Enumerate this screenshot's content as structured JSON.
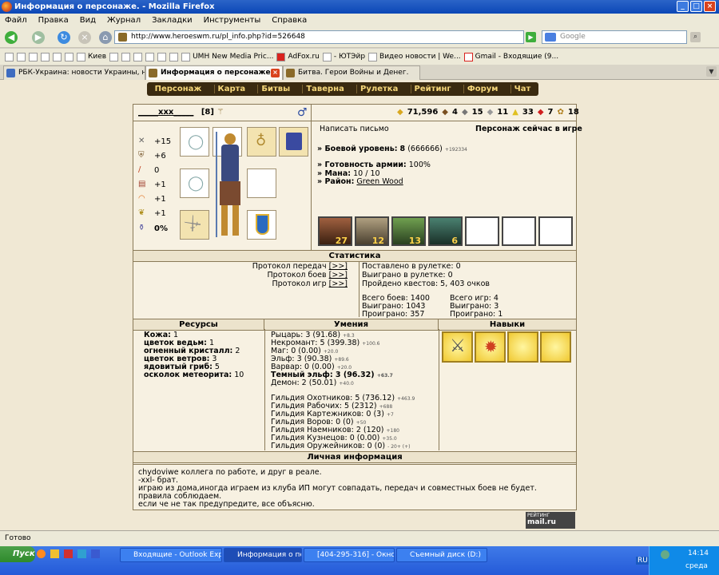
{
  "window": {
    "title": "Информация о персонаже. - Mozilla Firefox"
  },
  "menu": [
    "Файл",
    "Правка",
    "Вид",
    "Журнал",
    "Закладки",
    "Инструменты",
    "Справка"
  ],
  "url": "http://www.heroeswm.ru/pl_info.php?id=526648",
  "search_placeholder": "Google",
  "bookmarks": [
    "Киев",
    "UMH New Media Pric...",
    "AdFox.ru",
    "- ЮТЭйр",
    "Видео новости | We...",
    "Gmail - Входящие (9..."
  ],
  "tabs": [
    {
      "label": "РБК-Украина: новости Украины, но..."
    },
    {
      "label": "Информация о персонаже."
    },
    {
      "label": "Битва. Герои Войны и Денег."
    }
  ],
  "game_nav": [
    "Персонаж",
    "Карта",
    "Битвы",
    "Таверна",
    "Рулетка",
    "Рейтинг",
    "Форум",
    "Чат"
  ],
  "player": {
    "name": "_____xxx_____",
    "level": "[8]",
    "resources_top": [
      "71,596",
      "4",
      "15",
      "11",
      "33",
      "7",
      "18"
    ],
    "write_letter": "Написать письмо",
    "online_status": "Персонаж сейчас в игре",
    "combat_level_label": "» Боевой уровень:",
    "combat_level_value": "8",
    "combat_level_exp": "(666666)",
    "combat_level_plus": "+192334",
    "army_readiness_label": "» Готовность армии:",
    "army_readiness_value": "100%",
    "mana_label": "» Мана:",
    "mana_value": "10 / 10",
    "district_label": "» Район:",
    "district_value": "Green Wood"
  },
  "stats": [
    {
      "icon": "swords-icon",
      "value": "+15"
    },
    {
      "icon": "shield-icon",
      "value": "+6"
    },
    {
      "icon": "wand-icon",
      "value": "0"
    },
    {
      "icon": "book-icon",
      "value": "+1"
    },
    {
      "icon": "rainbow-icon",
      "value": "+1"
    },
    {
      "icon": "wings-icon",
      "value": "+1"
    },
    {
      "icon": "potion-icon",
      "value": "0%"
    }
  ],
  "army": [
    "27",
    "12",
    "13",
    "6",
    "",
    "",
    ""
  ],
  "sections": {
    "statistics": "Статистика",
    "resources": "Ресурсы",
    "skills": "Умения",
    "talents": "Навыки",
    "personal": "Личная информация"
  },
  "protocols": [
    {
      "label": "Протокол передач",
      "link": "[>>]"
    },
    {
      "label": "Протокол боев",
      "link": "[>>]"
    },
    {
      "label": "Протокол игр",
      "link": "[>>]"
    }
  ],
  "roulette": {
    "bet": "Поставлено в рулетке: 0",
    "won": "Выиграно в рулетке: 0",
    "quests": "Пройдено квестов: 5, 403 очков"
  },
  "battles": {
    "total": "Всего боев: 1400",
    "won": "Выиграно: 1043",
    "lost": "Проиграно: 357",
    "games_total": "Всего игр: 4",
    "games_won": "Выиграно: 3",
    "games_lost": "Проиграно: 1"
  },
  "resources": [
    {
      "name": "Кожа:",
      "value": "1"
    },
    {
      "name": "цветок ведьм:",
      "value": "1"
    },
    {
      "name": "огненный кристалл:",
      "value": "2"
    },
    {
      "name": "цветок ветров:",
      "value": "3"
    },
    {
      "name": "ядовитый гриб:",
      "value": "5"
    },
    {
      "name": "осколок метеорита:",
      "value": "10"
    }
  ],
  "skills": [
    {
      "text": "Рыцарь: 3 (91.68)",
      "plus": "+8.3"
    },
    {
      "text": "Некромант: 5 (399.38)",
      "plus": "+100.6"
    },
    {
      "text": "Маг: 0 (0.00)",
      "plus": "+20.0"
    },
    {
      "text": "Эльф: 3 (90.38)",
      "plus": "+89.6"
    },
    {
      "text": "Варвар: 0 (0.00)",
      "plus": "+20.0"
    },
    {
      "text": "Темный эльф: 3 (96.32)",
      "plus": "+63.7"
    },
    {
      "text": "Демон: 2 (50.01)",
      "plus": "+40.0"
    }
  ],
  "guilds": [
    {
      "text": "Гильдия Охотников: 5 (736.12)",
      "plus": "+463.9"
    },
    {
      "text": "Гильдия Рабочих: 5 (2312)",
      "plus": "+688"
    },
    {
      "text": "Гильдия Картежников: 0 (3)",
      "plus": "+7"
    },
    {
      "text": "Гильдия Воров: 0 (0)",
      "plus": "+50"
    },
    {
      "text": "Гильдия Наемников: 2 (120)",
      "plus": "+180"
    },
    {
      "text": "Гильдия Кузнецов: 0 (0.00)",
      "plus": "+35.0"
    },
    {
      "text": "Гильдия Оружейников: 0 (0)",
      "plus": "- 20+ (+)"
    }
  ],
  "personal_info": [
    "chydoviwe коллега по работе, и друг в реале.",
    "-xxl- брат.",
    "играю из дома,иногда играем из клуба ИП могут совпадать, передач и совместных боев не будет.",
    "правила соблюдаем.",
    "если че не так предупредите, все объясню."
  ],
  "counter": {
    "label": "РЕЙТИНГ",
    "value": "mail.ru"
  },
  "status": "Готово",
  "taskbar": {
    "start": "Пуск",
    "items": [
      "Входящие - Outlook Exp...",
      "Информация о персо...",
      "[404-295-316] - Окно со...",
      "Съемный диск (D:)"
    ],
    "lang": "RU",
    "time": "14:14",
    "day": "среда"
  }
}
